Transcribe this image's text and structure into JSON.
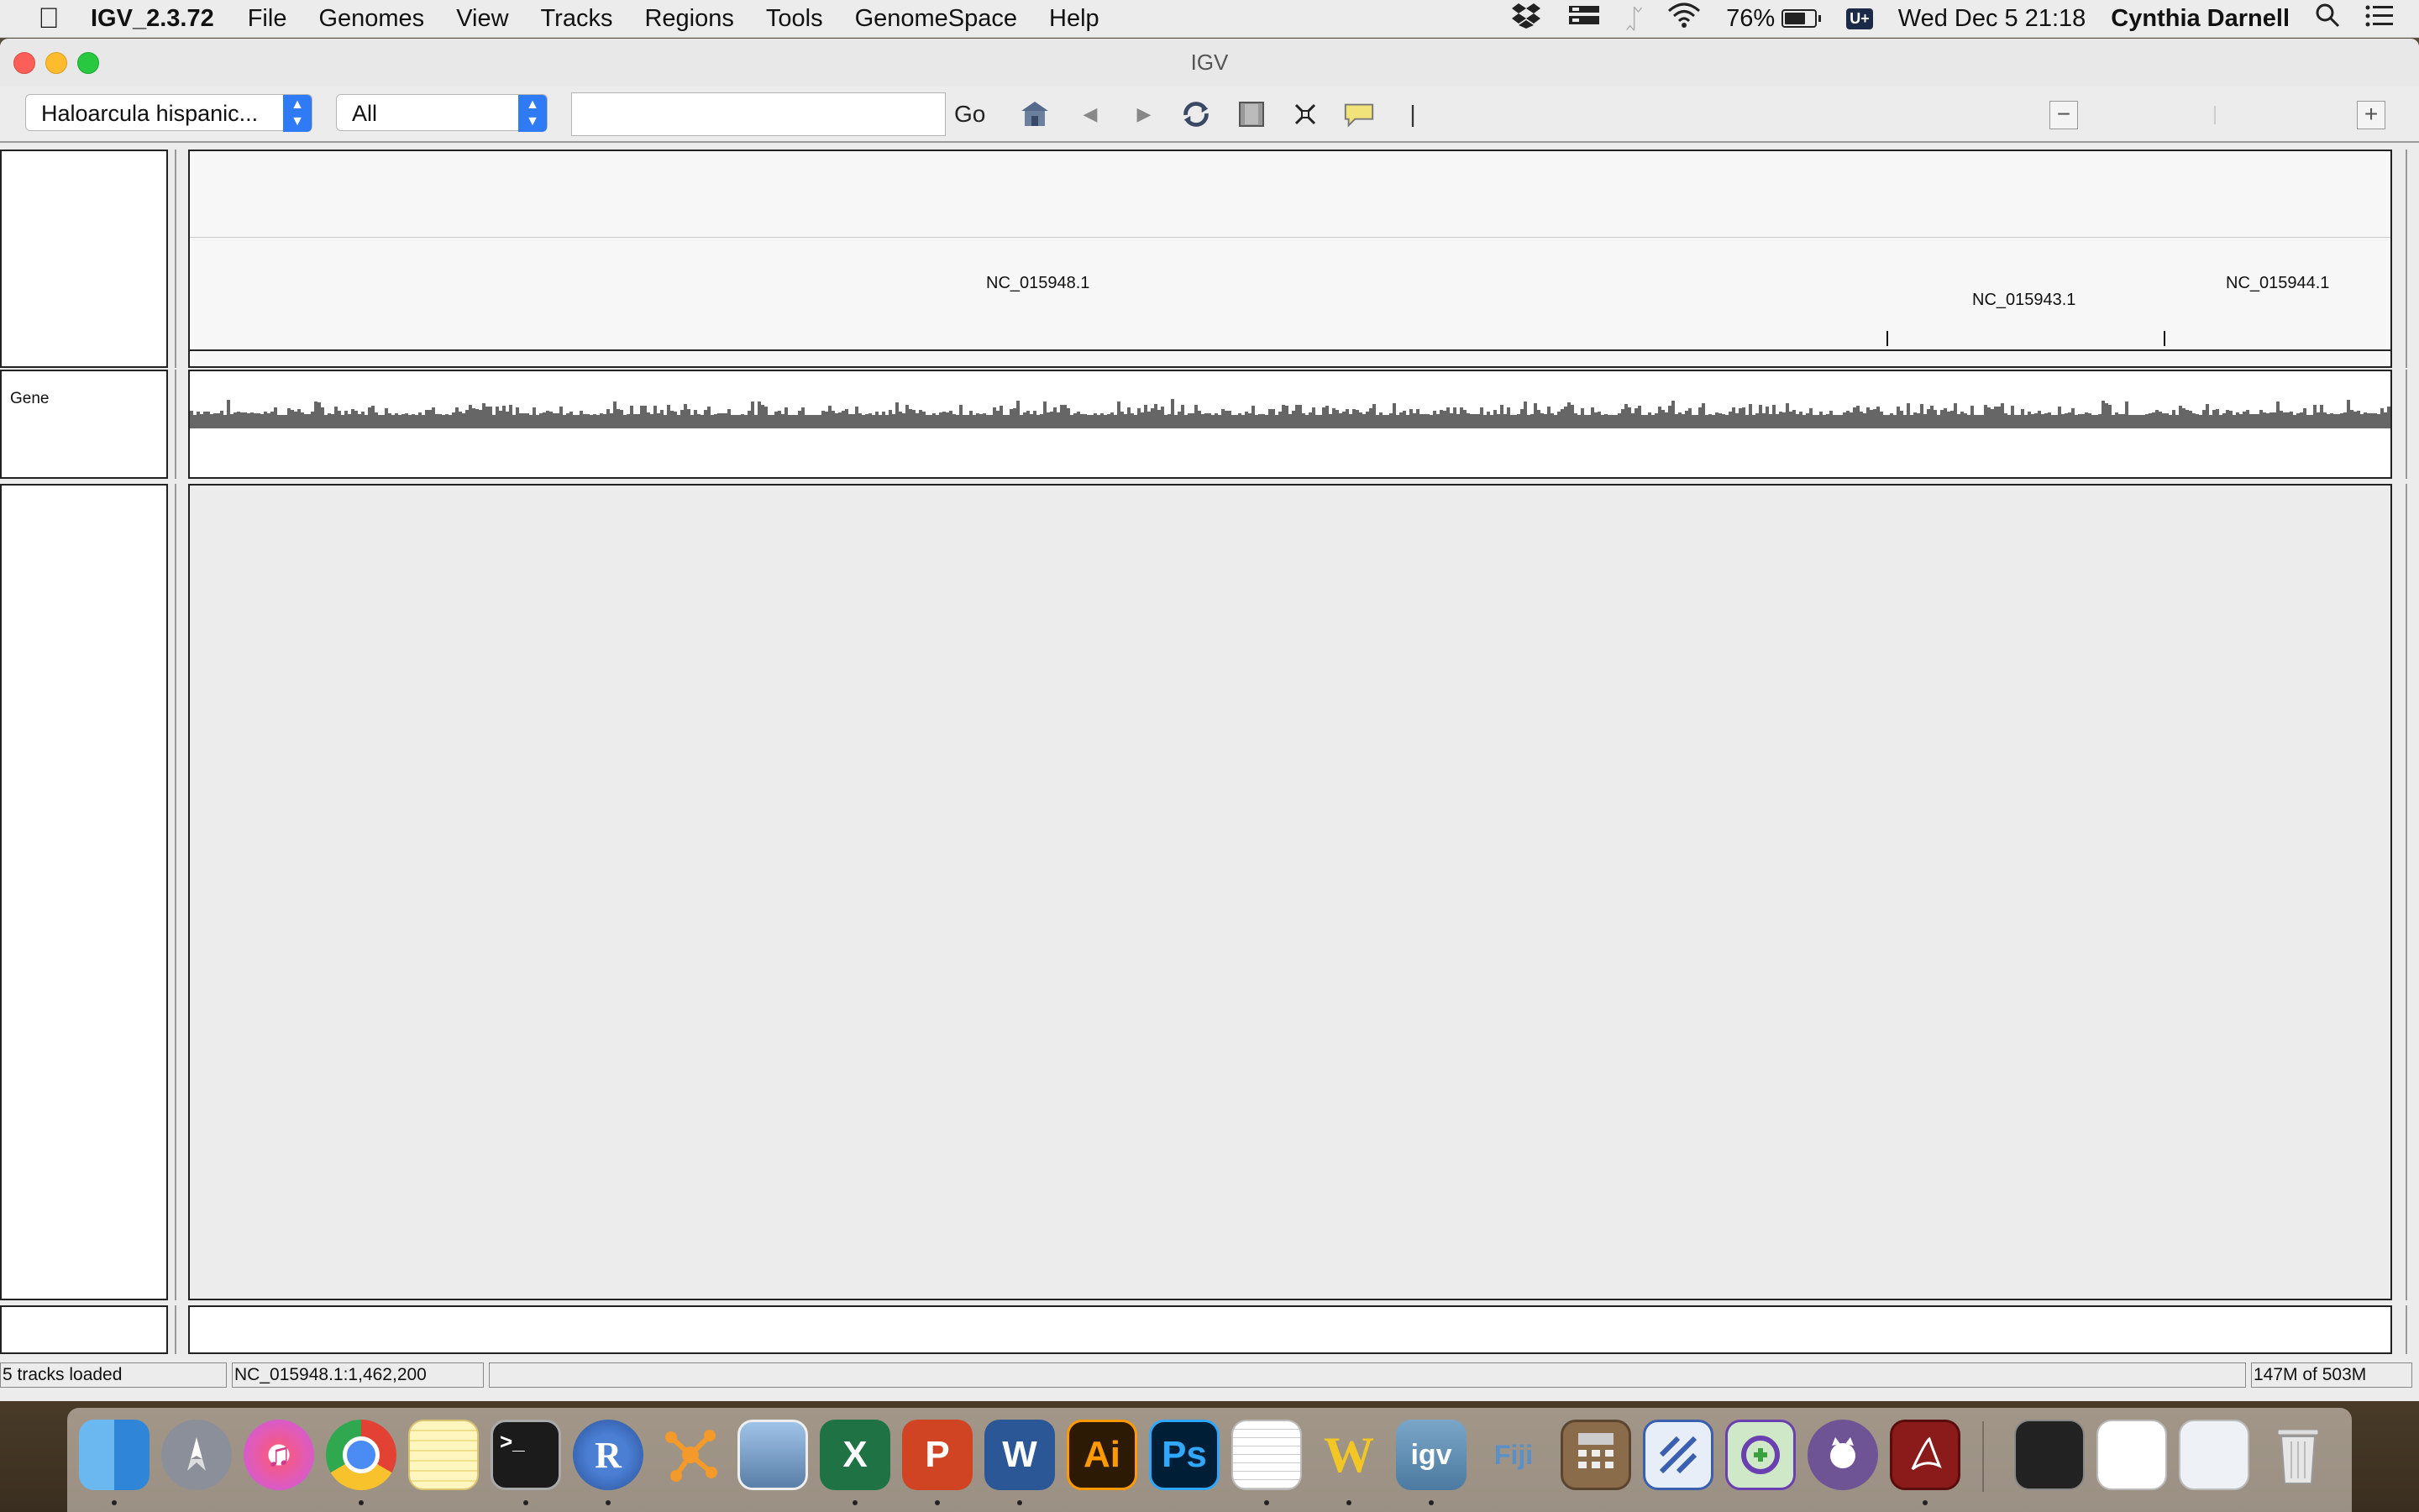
{
  "menubar": {
    "app_name": "IGV_2.3.72",
    "items": [
      "File",
      "Genomes",
      "View",
      "Tracks",
      "Regions",
      "Tools",
      "GenomeSpace",
      "Help"
    ],
    "battery": "76%",
    "battery_level": 0.76,
    "datetime": "Wed Dec 5  21:18",
    "user": "Cynthia Darnell",
    "input_badge": "U+"
  },
  "window": {
    "title": "IGV"
  },
  "toolbar": {
    "genome_select": "Haloarcula hispanic...",
    "chromosome_select": "All",
    "locus_value": "",
    "go_label": "Go",
    "zoom_out": "−",
    "zoom_in": "+"
  },
  "ruler": {
    "chromosomes": [
      {
        "name": "NC_015948.1"
      },
      {
        "name": "NC_015943.1"
      },
      {
        "name": "NC_015944.1"
      }
    ]
  },
  "tracks": {
    "gene_label": "Gene"
  },
  "statusbar": {
    "message": "5 tracks loaded",
    "position": "NC_015948.1:1,462,200",
    "center": "",
    "memory": "147M of 503M"
  },
  "dock": {
    "apps": [
      {
        "icon": "finder-icon",
        "label": ""
      },
      {
        "icon": "launchpad-icon",
        "label": ""
      },
      {
        "icon": "itunes-icon",
        "label": ""
      },
      {
        "icon": "chrome-icon",
        "label": ""
      },
      {
        "icon": "notes-icon",
        "label": ""
      },
      {
        "icon": "terminal-icon",
        "label": ">_"
      },
      {
        "icon": "r-icon",
        "label": "R"
      },
      {
        "icon": "cytoscape-icon",
        "label": ""
      },
      {
        "icon": "preview-icon",
        "label": ""
      },
      {
        "icon": "excel-icon",
        "label": "X"
      },
      {
        "icon": "powerpoint-icon",
        "label": "P"
      },
      {
        "icon": "word-icon",
        "label": "W"
      },
      {
        "icon": "illustrator-icon",
        "label": "Ai"
      },
      {
        "icon": "photoshop-icon",
        "label": "Ps"
      },
      {
        "icon": "textedit-icon",
        "label": ""
      },
      {
        "icon": "wiley-icon",
        "label": "W"
      },
      {
        "icon": "igv-icon",
        "label": "igv"
      },
      {
        "icon": "fiji-icon",
        "label": "Fiji"
      },
      {
        "icon": "calculator-icon",
        "label": ""
      },
      {
        "icon": "sourcetree-icon",
        "label": ""
      },
      {
        "icon": "citrix-icon",
        "label": ""
      },
      {
        "icon": "github-icon",
        "label": ""
      },
      {
        "icon": "acrobat-icon",
        "label": ""
      },
      {
        "icon": "downloads-stack-icon",
        "label": ""
      },
      {
        "icon": "document-stack-icon",
        "label": ""
      },
      {
        "icon": "screenshot-stack-icon",
        "label": ""
      },
      {
        "icon": "trash-icon",
        "label": ""
      }
    ]
  }
}
